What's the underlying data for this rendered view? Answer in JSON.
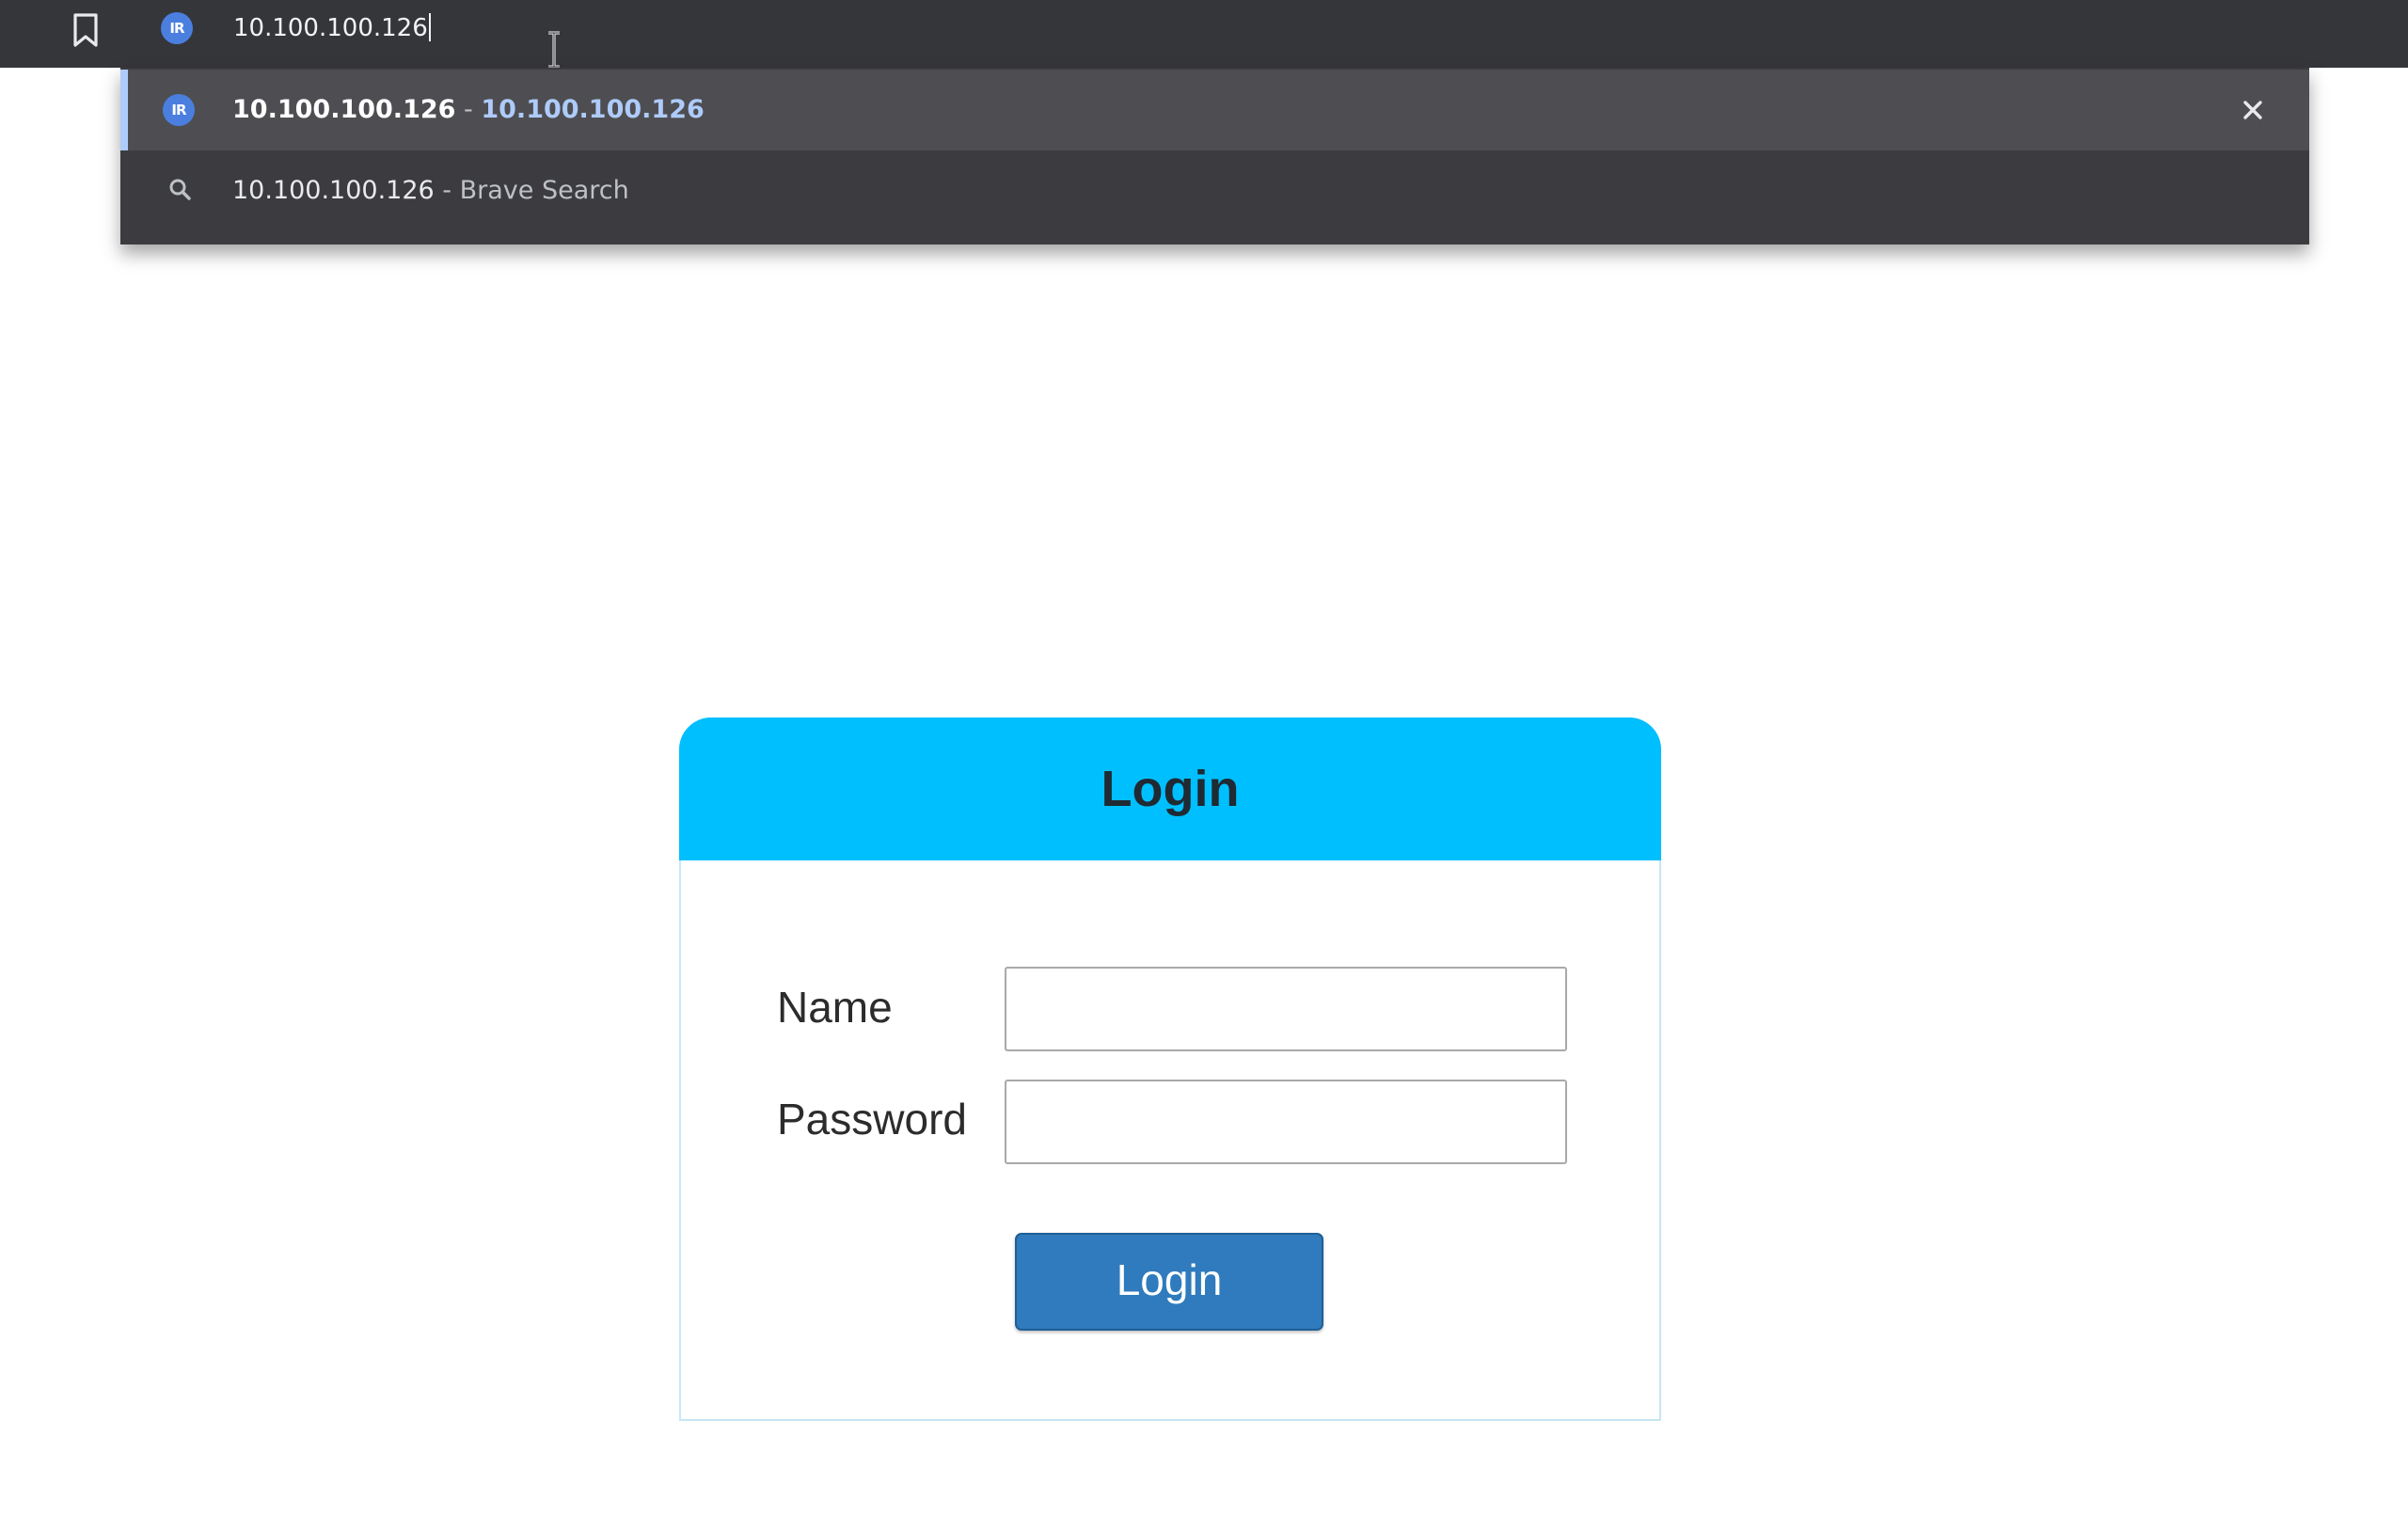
{
  "browser": {
    "address_bar": {
      "value": "10.100.100.126"
    },
    "site_icon_text": "IR",
    "icons": {
      "bookmark": "bookmark-icon",
      "site": "site-favicon",
      "cursor": "text-cursor-icon"
    }
  },
  "omnibox": {
    "suggestions": [
      {
        "primary": "10.100.100.126",
        "separator": " - ",
        "secondary": "10.100.100.126",
        "icon": "site-favicon",
        "removable": true
      },
      {
        "primary": "10.100.100.126",
        "separator": " - ",
        "secondary": "Brave Search",
        "icon": "search-icon"
      }
    ]
  },
  "login": {
    "title": "Login",
    "name_label": "Name",
    "password_label": "Password",
    "name_value": "",
    "password_value": "",
    "button_label": "Login"
  },
  "colors": {
    "toolbar": "#35363a",
    "dropdown": "#3c3c40",
    "accent_header": "#00bfff",
    "button": "#2f7bbd"
  }
}
